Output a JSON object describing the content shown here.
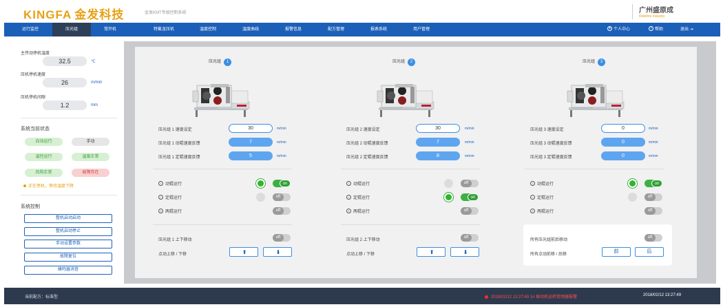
{
  "header": {
    "logo_en": "KINGFA",
    "logo_cn": "金发科技",
    "subtitle": "金发KMT专级控制系统",
    "brand_cn": "广州盛原成",
    "brand_en": "Ridefine Industry"
  },
  "nav": {
    "items": [
      "运行监控",
      "压光组",
      "常开机",
      "特氟龙压机",
      "温度控制",
      "温度曲线",
      "报警信息",
      "配方管理",
      "报表系统",
      "用户管理"
    ],
    "active": "压光组",
    "user": "个人中心",
    "help": "帮助",
    "logout": "退出"
  },
  "left": {
    "params": [
      {
        "label": "主传动停机温度",
        "value": "32.5",
        "unit": "℃"
      },
      {
        "label": "压机停机速度",
        "value": "26",
        "unit": "m/min"
      },
      {
        "label": "压机停机间隙",
        "value": "1.2",
        "unit": "mm"
      }
    ],
    "status_title": "系统当前状态",
    "status": [
      {
        "label": "自动运行",
        "tone": "green"
      },
      {
        "label": "手动",
        "tone": "gray"
      },
      {
        "label": "温控运行",
        "tone": "green"
      },
      {
        "label": "温度正常",
        "tone": "green"
      },
      {
        "label": "风险正常",
        "tone": "green"
      },
      {
        "label": "故障存在",
        "tone": "red"
      }
    ],
    "warning": "正在停机，等待温度下降",
    "control_title": "系统控制",
    "controls": [
      "整机启动启动",
      "整机启动停止",
      "手动设置参数",
      "故障复位",
      "蜂鸣器消音"
    ]
  },
  "groups": [
    {
      "title": "压光组",
      "num": "1",
      "rows": [
        {
          "label": "压光组 1 速度设定",
          "value": "30",
          "kind": "input",
          "unit": "m/min"
        },
        {
          "label": "压光组 1 动辊速度反馈",
          "value": "7",
          "kind": "feedback",
          "unit": "m/min"
        },
        {
          "label": "压光组 1 定辊速度反馈",
          "value": "5",
          "kind": "feedback",
          "unit": "m/min"
        }
      ],
      "modes": [
        {
          "label": "动辊运行",
          "icon": "↑",
          "lamp": true,
          "toggle": "on"
        },
        {
          "label": "定辊运行",
          "icon": "−",
          "lamp": false,
          "toggle": "off"
        },
        {
          "label": "两辊运行",
          "icon": "+",
          "lamp": null,
          "toggle": "off"
        }
      ],
      "move_label": "压光组 1 上下移动",
      "move_toggle": "off",
      "jog_label": "点动上移 / 下移"
    },
    {
      "title": "压光组",
      "num": "2",
      "rows": [
        {
          "label": "压光组 2 速度设定",
          "value": "30",
          "kind": "input",
          "unit": "m/min"
        },
        {
          "label": "压光组 2 动辊速度反馈",
          "value": "7",
          "kind": "feedback",
          "unit": "m/min"
        },
        {
          "label": "压光组 2 定辊速度反馈",
          "value": "8",
          "kind": "feedback",
          "unit": "m/min"
        }
      ],
      "modes": [
        {
          "label": "动辊运行",
          "icon": "↑",
          "lamp": false,
          "toggle": "off"
        },
        {
          "label": "定辊运行",
          "icon": "−",
          "lamp": true,
          "toggle": "on"
        },
        {
          "label": "两辊运行",
          "icon": "+",
          "lamp": null,
          "toggle": "off"
        }
      ],
      "move_label": "压光组 2 上下移动",
      "move_toggle": "off",
      "jog_label": "点动上移 / 下移"
    },
    {
      "title": "压光组",
      "num": "3",
      "rows": [
        {
          "label": "压光组 3 速度设定",
          "value": "0",
          "kind": "input",
          "unit": "m/min"
        },
        {
          "label": "压光组 3 动辊速度反馈",
          "value": "0",
          "kind": "feedback",
          "unit": "m/min"
        },
        {
          "label": "压光组 3 定辊速度反馈",
          "value": "0",
          "kind": "feedback",
          "unit": "m/min"
        }
      ],
      "modes": [
        {
          "label": "动辊运行",
          "icon": "↑",
          "lamp": true,
          "toggle": "on"
        },
        {
          "label": "定辊运行",
          "icon": "−",
          "lamp": false,
          "toggle": "off"
        },
        {
          "label": "两辊运行",
          "icon": "+",
          "lamp": null,
          "toggle": "off"
        }
      ],
      "move_label": "所有压光组前后移动",
      "move_toggle": "off",
      "jog_label": "所有点动前移 / 后移",
      "jog_front": "前",
      "jog_back": "后"
    }
  ],
  "toggle_text": {
    "on": "on",
    "off": "off"
  },
  "footer": {
    "recipe_label": "当前配方：",
    "recipe_value": "标准型",
    "alarm": "2018/02/12  13:27:49   1# 振动机运转变频器报警",
    "time": "2018/02/12  13:27:49"
  },
  "colors": {
    "nav": "#1c5fb8",
    "accent": "#e8a013",
    "on": "#33b233",
    "footer": "#2d3a4e"
  }
}
